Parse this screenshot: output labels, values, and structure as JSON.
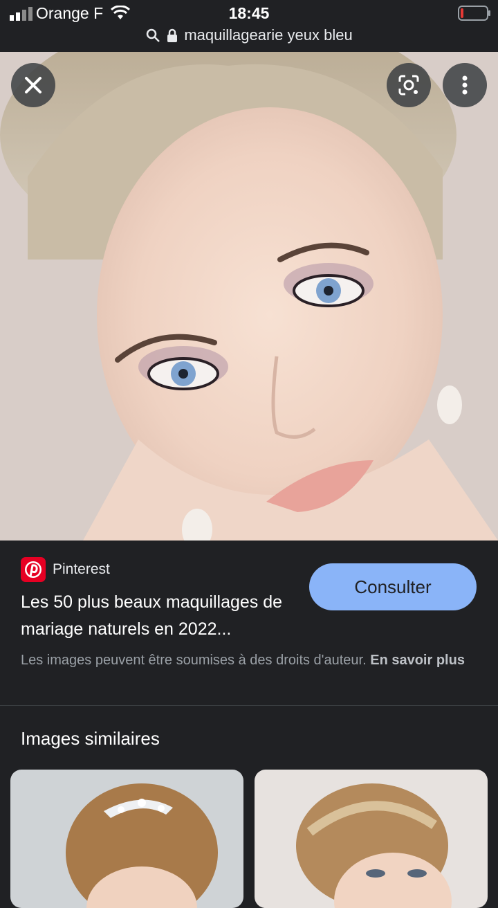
{
  "status_bar": {
    "carrier": "Orange F",
    "time": "18:45",
    "url": "maquillagearie yeux bleu",
    "battery_level": 0.08,
    "battery_color": "#e53935"
  },
  "hero": {
    "close_icon": "close-icon",
    "lens_icon": "lens-icon",
    "more_icon": "more-vertical-icon"
  },
  "result": {
    "source": "Pinterest",
    "source_color": "#e60023",
    "title": "Les 50 plus beaux maquillages de mariage naturels en 2022...",
    "visit_label": "Consulter",
    "accent": "#8ab4f8",
    "copyright_text": "Les images peuvent être soumises à des droits d'auteur.",
    "learn_more_label": "En savoir plus"
  },
  "similar": {
    "heading": "Images similaires"
  }
}
